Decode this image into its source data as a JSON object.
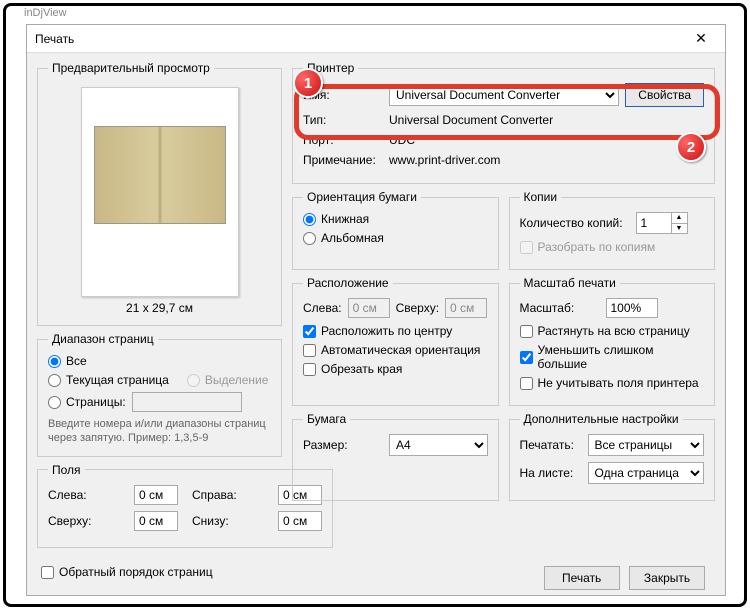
{
  "app_title": "inDjView",
  "dialog": {
    "title": "Печать"
  },
  "preview": {
    "legend": "Предварительный просмотр",
    "caption": "21 x 29,7 см"
  },
  "printer": {
    "legend": "Принтер",
    "name_label": "Имя:",
    "name_value": "Universal Document Converter",
    "props_btn": "Свойства",
    "type_label": "Тип:",
    "type_value": "Universal Document Converter",
    "port_label": "Порт:",
    "port_value": "UDC",
    "note_label": "Примечание:",
    "note_value": "www.print-driver.com"
  },
  "orient": {
    "legend": "Ориентация бумаги",
    "portrait": "Книжная",
    "landscape": "Альбомная"
  },
  "copies": {
    "legend": "Копии",
    "count_label": "Количество копий:",
    "count_value": "1",
    "collate": "Разобрать по копиям"
  },
  "range": {
    "legend": "Диапазон страниц",
    "all": "Все",
    "current": "Текущая страница",
    "selection": "Выделение",
    "pages": "Страницы:",
    "pages_value": "",
    "hint": "Введите номера и/или диапазоны страниц через запятую. Пример: 1,3,5-9"
  },
  "pos": {
    "legend": "Расположение",
    "left_label": "Слева:",
    "left_value": "0 см",
    "top_label": "Сверху:",
    "top_value": "0 см",
    "center": "Расположить по центру",
    "auto_orient": "Автоматическая ориентация",
    "crop": "Обрезать края"
  },
  "scale": {
    "legend": "Масштаб печати",
    "scale_label": "Масштаб:",
    "scale_value": "100%",
    "fit": "Растянуть на всю страницу",
    "shrink": "Уменьшить слишком большие",
    "ignore_margins": "Не учитывать поля принтера"
  },
  "margins": {
    "legend": "Поля",
    "left": "Слева:",
    "left_v": "0 см",
    "right": "Справа:",
    "right_v": "0 см",
    "top": "Сверху:",
    "top_v": "0 см",
    "bottom": "Снизу:",
    "bottom_v": "0 см"
  },
  "paper": {
    "legend": "Бумага",
    "size_label": "Размер:",
    "size_value": "A4"
  },
  "extra": {
    "legend": "Дополнительные настройки",
    "print_label": "Печатать:",
    "print_value": "Все страницы",
    "sheet_label": "На листе:",
    "sheet_value": "Одна страница"
  },
  "reverse": "Обратный порядок страниц",
  "buttons": {
    "print": "Печать",
    "close": "Закрыть"
  },
  "callouts": {
    "one": "1",
    "two": "2"
  }
}
